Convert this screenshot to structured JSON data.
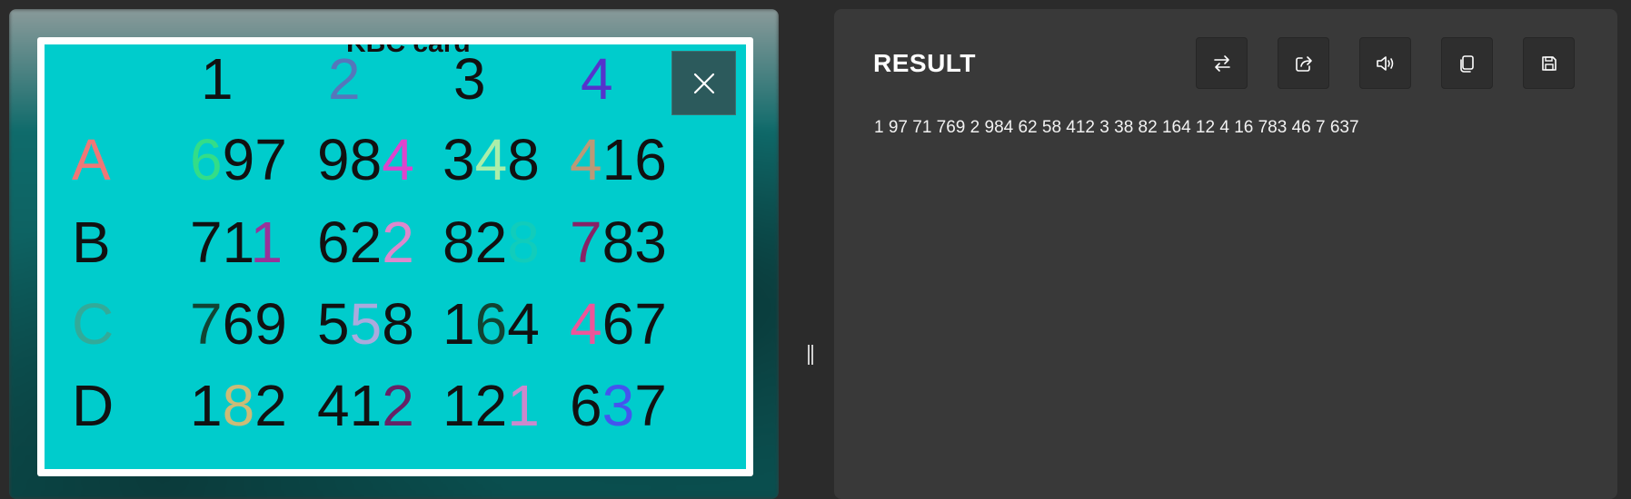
{
  "card": {
    "title": "KBC card",
    "columns": [
      {
        "label": "1",
        "color": "#111111"
      },
      {
        "label": "2",
        "color": "#5577bb"
      },
      {
        "label": "3",
        "color": "#111111"
      },
      {
        "label": "4",
        "color": "#5533cc"
      }
    ],
    "rows": [
      {
        "label": "A",
        "label_color": "#ef7777",
        "cells": [
          [
            {
              "t": "6",
              "c": "#33dd88"
            },
            {
              "t": "97",
              "c": "#111111"
            }
          ],
          [
            {
              "t": "98",
              "c": "#111111"
            },
            {
              "t": "4",
              "c": "#dd44cc"
            }
          ],
          [
            {
              "t": "3",
              "c": "#111111"
            },
            {
              "t": "4",
              "c": "#aaeeaa"
            },
            {
              "t": "8",
              "c": "#111111"
            }
          ],
          [
            {
              "t": "4",
              "c": "#bb9977"
            },
            {
              "t": "16",
              "c": "#111111"
            }
          ]
        ]
      },
      {
        "label": "B",
        "label_color": "#111111",
        "cells": [
          [
            {
              "t": "71",
              "c": "#111111"
            },
            {
              "t": "1",
              "c": "#993399"
            }
          ],
          [
            {
              "t": "62",
              "c": "#111111"
            },
            {
              "t": "2",
              "c": "#dd88cc"
            }
          ],
          [
            {
              "t": "82",
              "c": "#111111"
            },
            {
              "t": "8",
              "c": "#11ccbb"
            }
          ],
          [
            {
              "t": "7",
              "c": "#882266"
            },
            {
              "t": "83",
              "c": "#111111"
            }
          ]
        ]
      },
      {
        "label": "C",
        "label_color": "#33aa99",
        "cells": [
          [
            {
              "t": "7",
              "c": "#114433"
            },
            {
              "t": "69",
              "c": "#111111"
            }
          ],
          [
            {
              "t": "5",
              "c": "#111111"
            },
            {
              "t": "5",
              "c": "#aaaadd"
            },
            {
              "t": "8",
              "c": "#111111"
            }
          ],
          [
            {
              "t": "1",
              "c": "#111111"
            },
            {
              "t": "6",
              "c": "#114433"
            },
            {
              "t": "4",
              "c": "#111111"
            }
          ],
          [
            {
              "t": "4",
              "c": "#ee5599"
            },
            {
              "t": "67",
              "c": "#111111"
            }
          ]
        ]
      },
      {
        "label": "D",
        "label_color": "#111111",
        "cells": [
          [
            {
              "t": "1",
              "c": "#111111"
            },
            {
              "t": "8",
              "c": "#ccbb77"
            },
            {
              "t": "2",
              "c": "#111111"
            }
          ],
          [
            {
              "t": "41",
              "c": "#111111"
            },
            {
              "t": "2",
              "c": "#662266"
            }
          ],
          [
            {
              "t": "12",
              "c": "#111111"
            },
            {
              "t": "1",
              "c": "#cc88cc"
            }
          ],
          [
            {
              "t": "6",
              "c": "#111111"
            },
            {
              "t": "3",
              "c": "#4455ee"
            },
            {
              "t": "7",
              "c": "#111111"
            }
          ]
        ]
      }
    ]
  },
  "close_button": {
    "icon": "close-icon"
  },
  "result": {
    "title": "RESULT",
    "text": "1 97 71 769 2 984 62 58 412 3 38 82 164 12 4 16 783 46 7 637",
    "toolbar": [
      {
        "name": "swap-button",
        "icon": "swap-icon"
      },
      {
        "name": "share-button",
        "icon": "share-icon"
      },
      {
        "name": "speak-button",
        "icon": "speaker-icon"
      },
      {
        "name": "copy-button",
        "icon": "copy-icon"
      },
      {
        "name": "save-button",
        "icon": "save-icon"
      }
    ]
  },
  "colors": {
    "accent_cyan": "#00cccc",
    "panel": "#393939",
    "background": "#2b2b2b"
  }
}
